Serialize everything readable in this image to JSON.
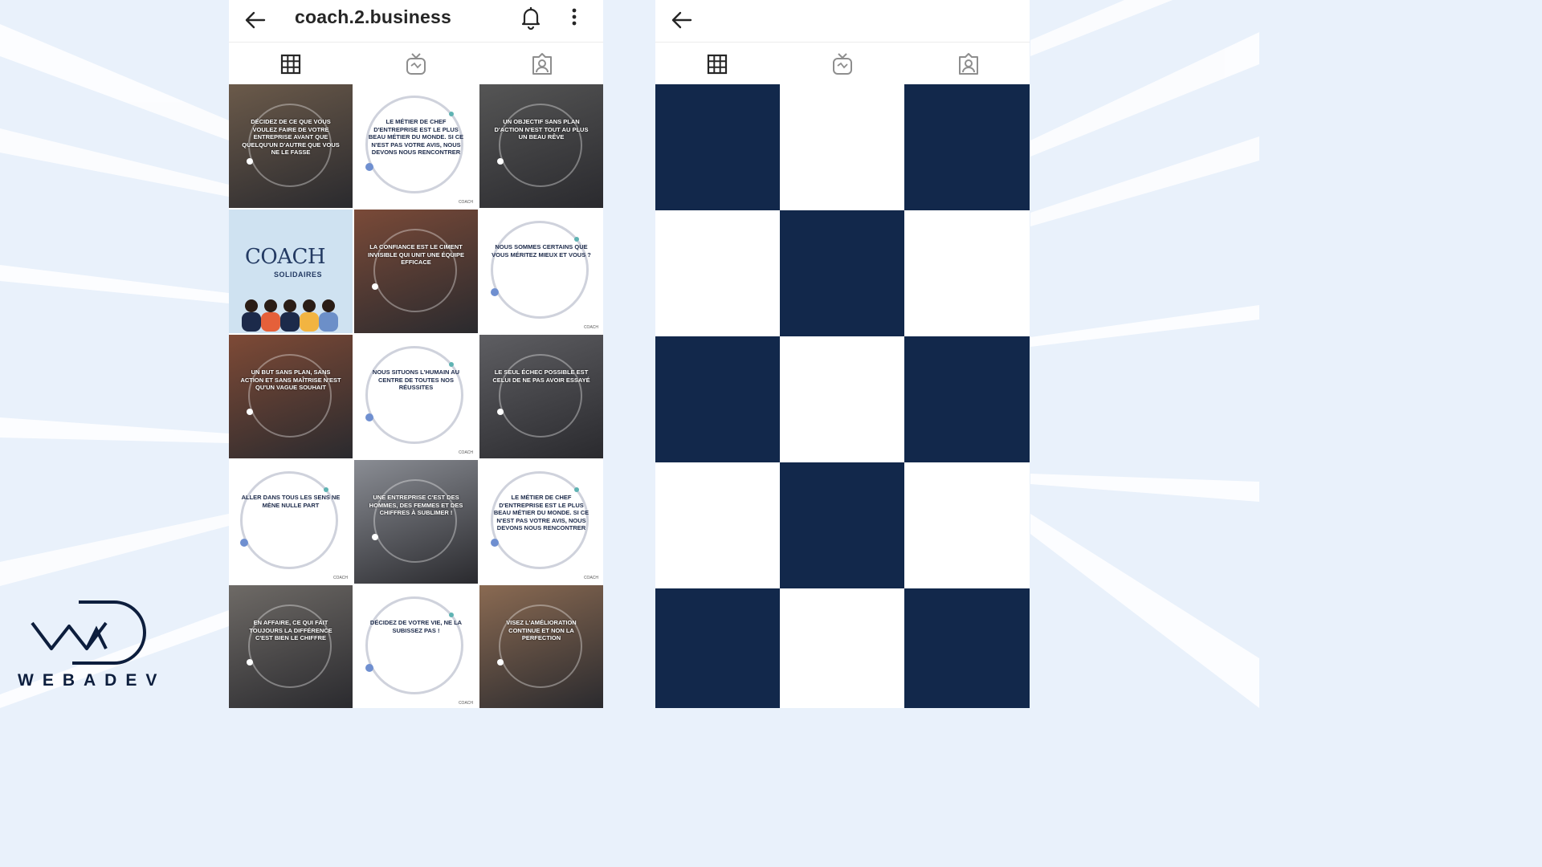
{
  "background": {
    "color": "#e9f1fb",
    "ray_color": "#ffffff"
  },
  "left_phone": {
    "profile_name": "coach.2.business",
    "icons": {
      "back": "arrow-left-icon",
      "notifications": "bell-icon",
      "menu": "more-vertical-icon"
    },
    "tabs": [
      {
        "icon": "grid-icon",
        "active": true
      },
      {
        "icon": "igtv-icon",
        "active": false
      },
      {
        "icon": "tagged-icon",
        "active": false
      }
    ],
    "posts": [
      {
        "kind": "photo",
        "bg": "#6b5a4a",
        "text": "Décidez de ce que vous voulez faire de votre entreprise avant que quelqu'un d'autre que vous ne le fasse"
      },
      {
        "kind": "quote",
        "text": "Le métier de chef d'entreprise est le plus beau métier du monde. Si ce n'est pas votre avis, nous devons nous rencontrer"
      },
      {
        "kind": "photo",
        "bg": "#555555",
        "text": "Un objectif sans plan d'action n'est tout au plus un beau rêve"
      },
      {
        "kind": "logo",
        "logo_text": "COACH",
        "logo_sub": "SOLIDAIRES"
      },
      {
        "kind": "photo",
        "bg": "#7a4a38",
        "text": "La confiance est le ciment invisible qui unit une équipe efficace"
      },
      {
        "kind": "quote",
        "text": "Nous sommes certains que vous méritez mieux et vous ?"
      },
      {
        "kind": "photo",
        "bg": "#7e4a36",
        "text": "Un but sans plan, sans action et sans maîtrise n'est qu'un vague souhait"
      },
      {
        "kind": "quote",
        "text": "Nous situons l'humain au centre de toutes nos réussites"
      },
      {
        "kind": "photo",
        "bg": "#5e5e62",
        "text": "Le seul échec possible est celui de ne pas avoir essayé"
      },
      {
        "kind": "quote",
        "text": "Aller dans tous les sens ne mène nulle part"
      },
      {
        "kind": "photo",
        "bg": "#8a8d94",
        "text": "Une entreprise c'est des hommes, des femmes et des chiffres à sublimer !"
      },
      {
        "kind": "quote",
        "text": "Le métier de chef d'entreprise est le plus beau métier du monde. Si ce n'est pas votre avis, nous devons nous rencontrer"
      },
      {
        "kind": "photo",
        "bg": "#6e6a66",
        "text": "En affaire, ce qui fait toujours la différence c'est bien le chiffre"
      },
      {
        "kind": "quote",
        "text": "Décidez de votre vie, ne la subissez pas !"
      },
      {
        "kind": "photo",
        "bg": "#8a6a52",
        "text": "Visez l'amélioration continue et non la perfection"
      }
    ],
    "quote_watermark": "COACH"
  },
  "right_phone": {
    "icons": {
      "back": "arrow-left-icon"
    },
    "tabs": [
      {
        "icon": "grid-icon",
        "active": true
      },
      {
        "icon": "igtv-icon",
        "active": false
      },
      {
        "icon": "tagged-icon",
        "active": false
      }
    ],
    "pattern": [
      [
        "navy",
        "white",
        "navy"
      ],
      [
        "white",
        "navy",
        "white"
      ],
      [
        "navy",
        "white",
        "navy"
      ],
      [
        "white",
        "navy",
        "white"
      ],
      [
        "navy",
        "white",
        "navy"
      ]
    ],
    "colors": {
      "navy": "#12284b",
      "white": "#ffffff"
    }
  },
  "brand": {
    "logo_icon": "webadev-logo-icon",
    "name": "WEBADEV",
    "color": "#0d1e3d"
  }
}
